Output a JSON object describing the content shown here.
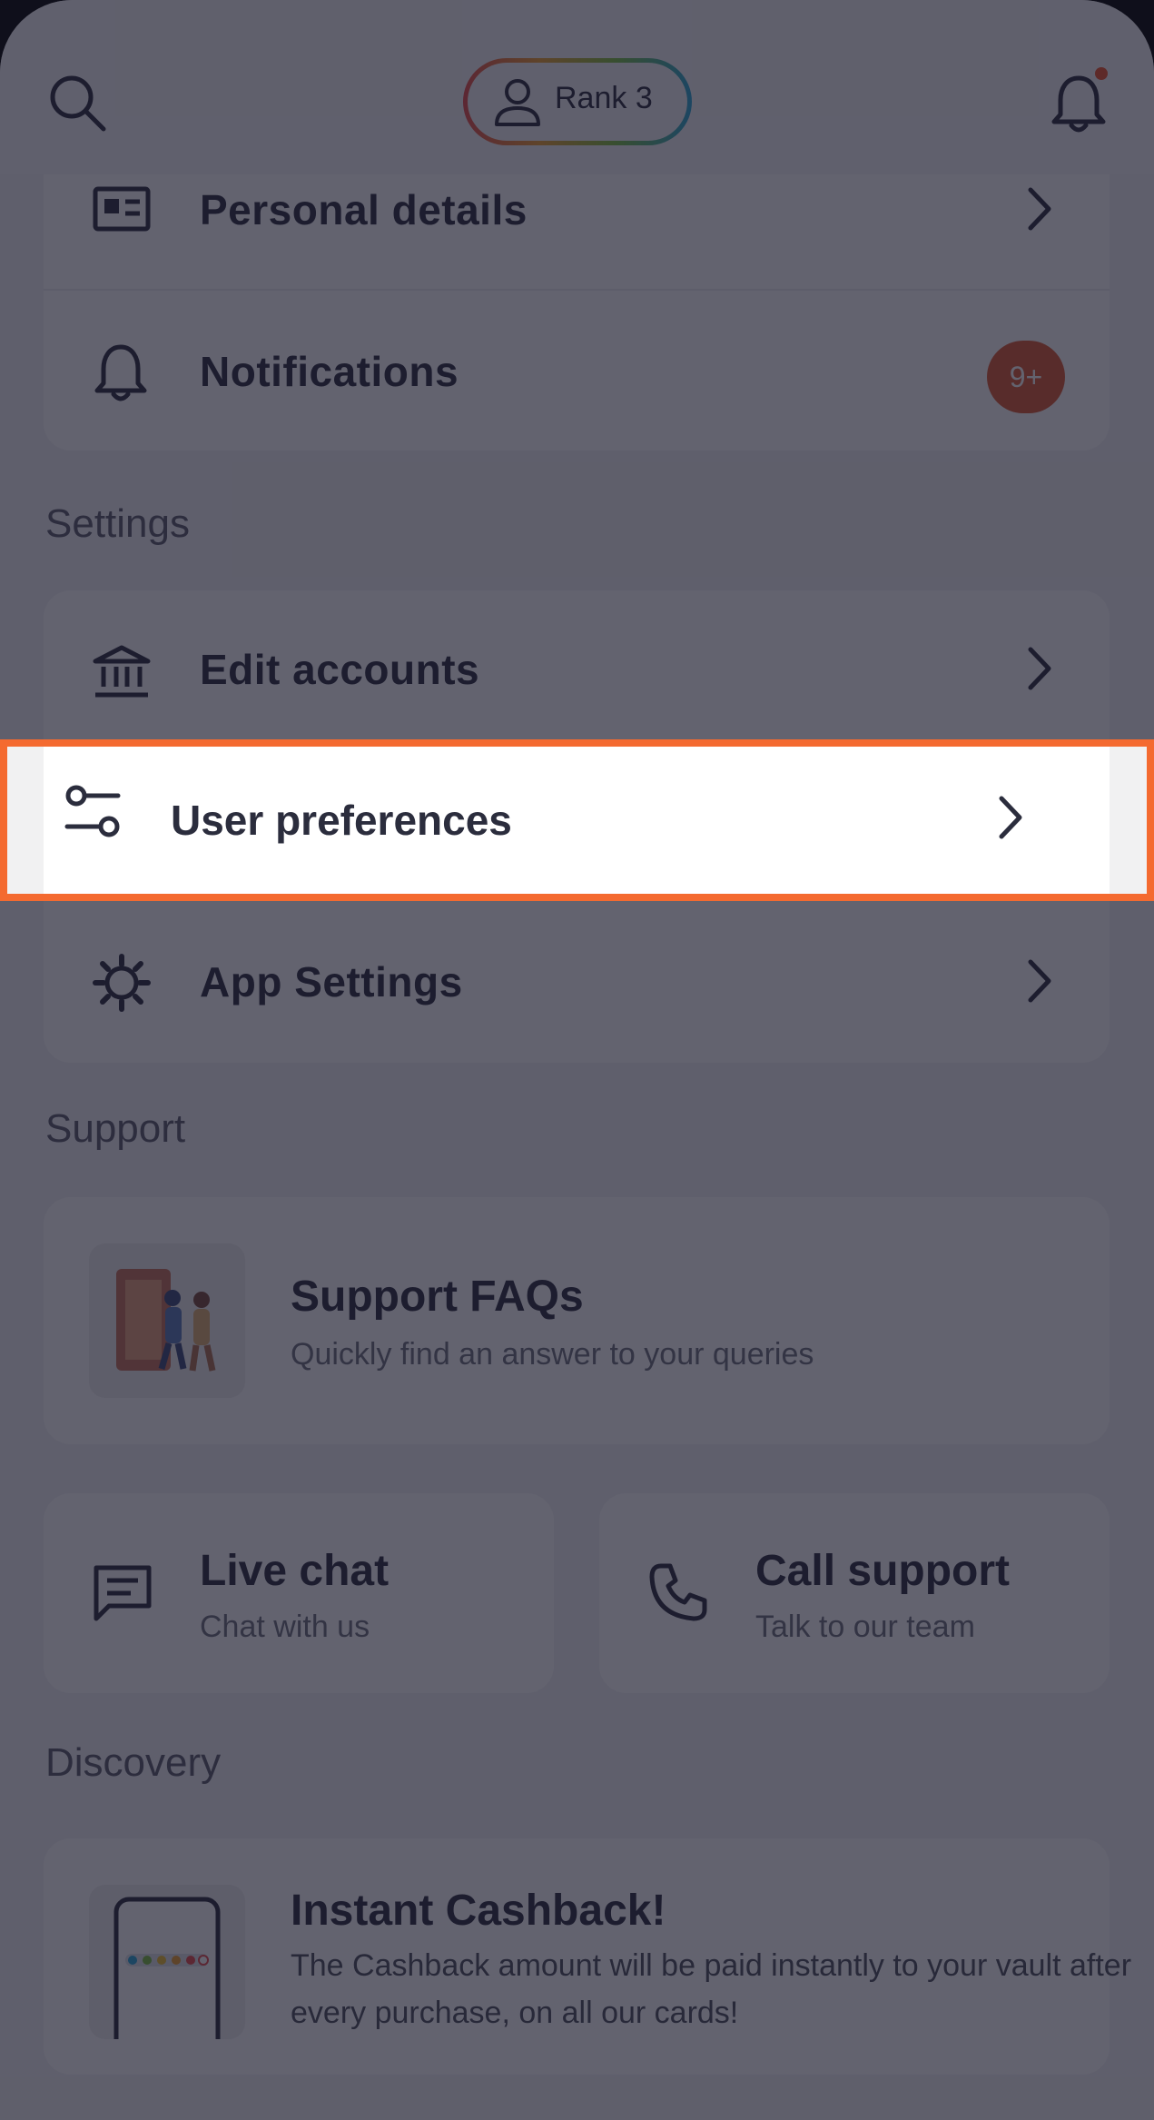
{
  "header": {
    "search_icon": "search-icon",
    "rank_label": "Rank 3",
    "notification_icon": "bell-icon",
    "has_unread": true
  },
  "account_section": {
    "items": [
      {
        "label": "Personal details",
        "icon": "id-card-icon"
      },
      {
        "label": "Notifications",
        "icon": "bell-icon",
        "badge": "9+"
      }
    ]
  },
  "settings_section": {
    "title": "Settings",
    "items": [
      {
        "label": "Edit accounts",
        "icon": "bank-icon"
      },
      {
        "label": "User preferences",
        "icon": "sliders-icon",
        "highlighted": true
      },
      {
        "label": "App Settings",
        "icon": "gear-icon"
      }
    ]
  },
  "support_section": {
    "title": "Support",
    "faq": {
      "title": "Support FAQs",
      "subtitle": "Quickly find an answer to your queries"
    },
    "live_chat": {
      "title": "Live chat",
      "subtitle": "Chat with us"
    },
    "call_support": {
      "title": "Call support",
      "subtitle": "Talk to our team"
    }
  },
  "discovery_section": {
    "title": "Discovery",
    "cashback": {
      "title": "Instant Cashback!",
      "description": "The Cashback amount will be paid instantly to your vault after every purchase, on all our cards!"
    }
  },
  "colors": {
    "highlight_border": "#f46a30",
    "badge": "#dd5a33",
    "text_primary": "#2b2d3d"
  }
}
